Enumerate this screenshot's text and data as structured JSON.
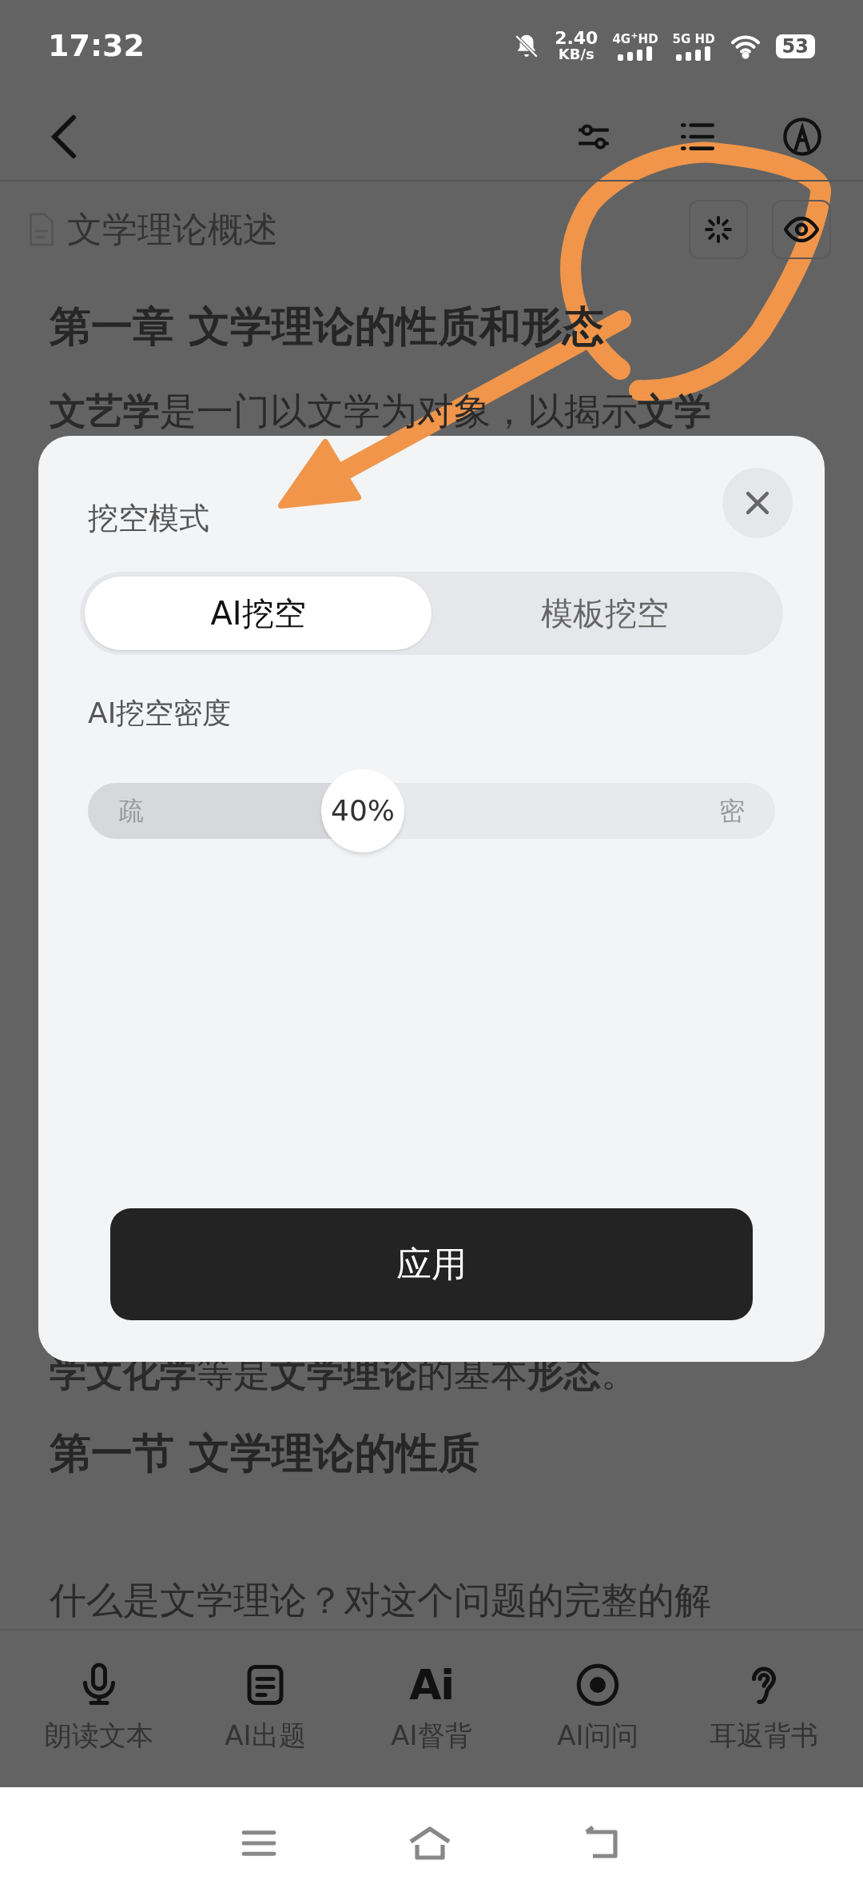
{
  "status_bar": {
    "time": "17:32",
    "speed": "2.40",
    "speed_unit": "KB/s",
    "network_1": "4G$^{+}$HD",
    "network_2": "5G HD",
    "battery": "53"
  },
  "document": {
    "title": "文学理论概述",
    "lines": [
      {
        "kind": "heading",
        "text": "第一章 **文学理论**的性质和形态"
      },
      {
        "kind": "para",
        "text": "**文艺学**是一门以文学为对象，以揭示**文学**"
      },
      {
        "kind": "para",
        "text": "**学文化学**等是**文学理论**的基本**形态**。"
      },
      {
        "kind": "heading",
        "text": "第一节 **文学**理论的性质"
      },
      {
        "kind": "gap"
      },
      {
        "kind": "para",
        "text": "什么是文学理论？对这个问题的完整的解"
      }
    ]
  },
  "dialog": {
    "title": "挖空模式",
    "modes": [
      {
        "label": "AI挖空",
        "selected": true
      },
      {
        "label": "模板挖空",
        "selected": false
      }
    ],
    "density_label": "AI挖空密度",
    "slider": {
      "low": "疏",
      "high": "密",
      "reading": "40%",
      "level": 0.4
    },
    "apply": "应用"
  },
  "toolbar": [
    {
      "kind": "mic",
      "label": "朗读文本"
    },
    {
      "kind": "doc",
      "label": "AI出题"
    },
    {
      "kind": "ai",
      "glyph": "Ai",
      "label": "AI督背"
    },
    {
      "kind": "record",
      "label": "AI问问"
    },
    {
      "kind": "ear",
      "label": "耳返背书"
    }
  ]
}
